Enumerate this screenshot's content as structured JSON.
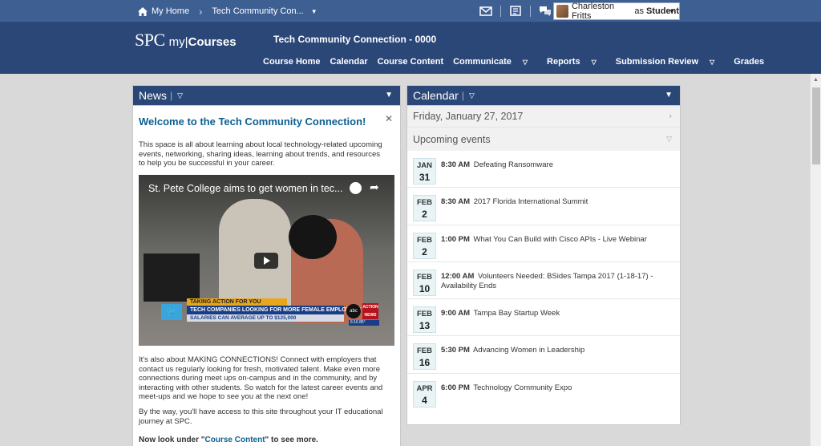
{
  "topbar": {
    "home": "My Home",
    "course": "Tech Community Con...",
    "user_name": "Charleston Fritts",
    "user_as": "as",
    "user_role": "Student"
  },
  "header": {
    "logo_spc": "SPC",
    "logo_my": "my|",
    "logo_courses": "Courses",
    "course_title": "Tech Community Connection - 0000",
    "nav": [
      "Course Home",
      "Calendar",
      "Course Content",
      "Communicate",
      "Reports",
      "Submission Review",
      "Grades"
    ]
  },
  "news": {
    "heading": "News",
    "title": "Welcome to the Tech Community Connection!",
    "para1": "This space is all about learning about local technology-related upcoming events, networking, sharing ideas, learning about trends, and resources to help you be successful in your career.",
    "video_title": "St. Pete College aims to get women in tec...",
    "video_strip1": "TAKING ACTION FOR YOU",
    "video_strip2": "TECH COMPANIES LOOKING FOR MORE FEMALE EMPLOYEES",
    "video_strip3": "SALARIES CAN AVERAGE UP TO $125,000",
    "video_abc": "abc",
    "video_action": "ACTION NEWS",
    "video_temp": "6:16  85°",
    "para2": "It's also about MAKING CONNECTIONS! Connect with employers that contact us regularly looking for fresh, motivated talent. Make even more connections during meet ups on-campus and in the community, and by interacting with other students. So watch for the latest career events and meet-ups and we hope to see you at the next one!",
    "para3": "By the way, you'll have access to this site throughout your IT educational journey at SPC.",
    "para4_prefix": "Now look under \"",
    "para4_link": "Course Content",
    "para4_suffix": "\" to see more."
  },
  "calendar": {
    "heading": "Calendar",
    "current_date": "Friday, January 27, 2017",
    "upcoming_label": "Upcoming events",
    "events": [
      {
        "month": "JAN",
        "day": "31",
        "time": "8:30 AM",
        "title": "Defeating Ransomware"
      },
      {
        "month": "FEB",
        "day": "2",
        "time": "8:30 AM",
        "title": "2017 Florida International Summit"
      },
      {
        "month": "FEB",
        "day": "2",
        "time": "1:00 PM",
        "title": "What You Can Build with Cisco APIs - Live Webinar"
      },
      {
        "month": "FEB",
        "day": "10",
        "time": "12:00 AM",
        "title": "Volunteers Needed: BSides Tampa 2017 (1-18-17) - Availability Ends"
      },
      {
        "month": "FEB",
        "day": "13",
        "time": "9:00 AM",
        "title": "Tampa Bay Startup Week"
      },
      {
        "month": "FEB",
        "day": "16",
        "time": "5:30 PM",
        "title": "Advancing Women in Leadership"
      },
      {
        "month": "APR",
        "day": "4",
        "time": "6:00 PM",
        "title": "Technology Community Expo"
      }
    ]
  },
  "colors": {
    "topbar": "#3e5f92",
    "header": "#2a4778",
    "link": "#0b5f91"
  }
}
